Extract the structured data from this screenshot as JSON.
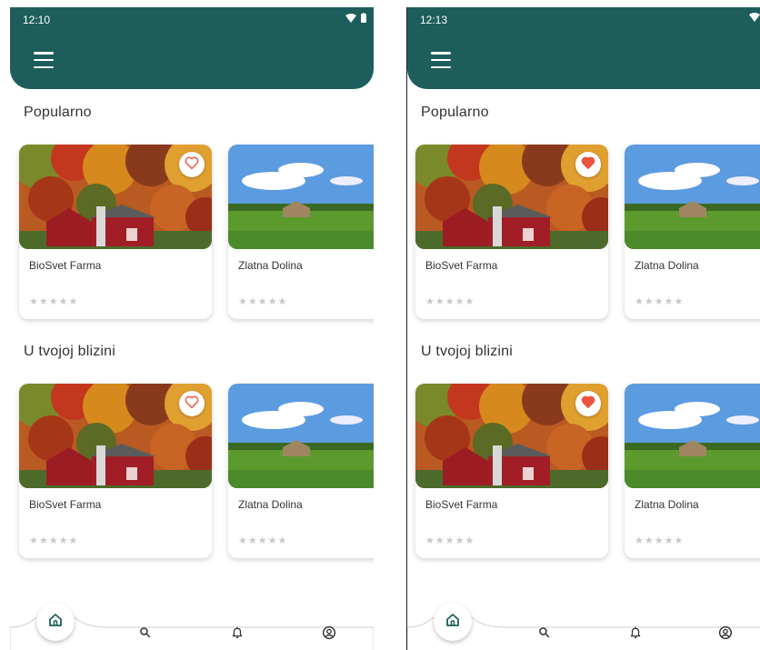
{
  "screens": [
    {
      "id": "left",
      "status": {
        "time": "12:10"
      },
      "favorited": false,
      "sections": [
        {
          "title": "Popularno",
          "cards": [
            {
              "name": "BioSvet Farma",
              "stars": "★★★★★"
            },
            {
              "name": "Zlatna Dolina",
              "stars": "★★★★★"
            }
          ]
        },
        {
          "title": "U tvojoj blizini",
          "cards": [
            {
              "name": "BioSvet Farma",
              "stars": "★★★★★"
            },
            {
              "name": "Zlatna Dolina",
              "stars": "★★★★★"
            }
          ]
        }
      ]
    },
    {
      "id": "right",
      "status": {
        "time": "12:13"
      },
      "favorited": true,
      "sections": [
        {
          "title": "Popularno",
          "cards": [
            {
              "name": "BioSvet Farma",
              "stars": "★★★★★"
            },
            {
              "name": "Zlatna Dolina",
              "stars": "★★★★★"
            }
          ]
        },
        {
          "title": "U tvojoj blizini",
          "cards": [
            {
              "name": "BioSvet Farma",
              "stars": "★★★★★"
            },
            {
              "name": "Zlatna Dolina",
              "stars": "★★★★★"
            }
          ]
        }
      ]
    }
  ],
  "colors": {
    "appbar": "#1d5e5c",
    "heart": "#e8543f",
    "heart_outline": "#e8543f",
    "star_empty": "#c8c8c8",
    "nav_icon": "#1d5e5c"
  },
  "icons": {
    "menu": "menu-icon",
    "favorite": "heart-icon",
    "home": "home-icon",
    "search": "search-icon",
    "notifications": "bell-icon",
    "profile": "user-circle-icon",
    "wifi": "wifi-icon",
    "battery": "battery-icon"
  }
}
